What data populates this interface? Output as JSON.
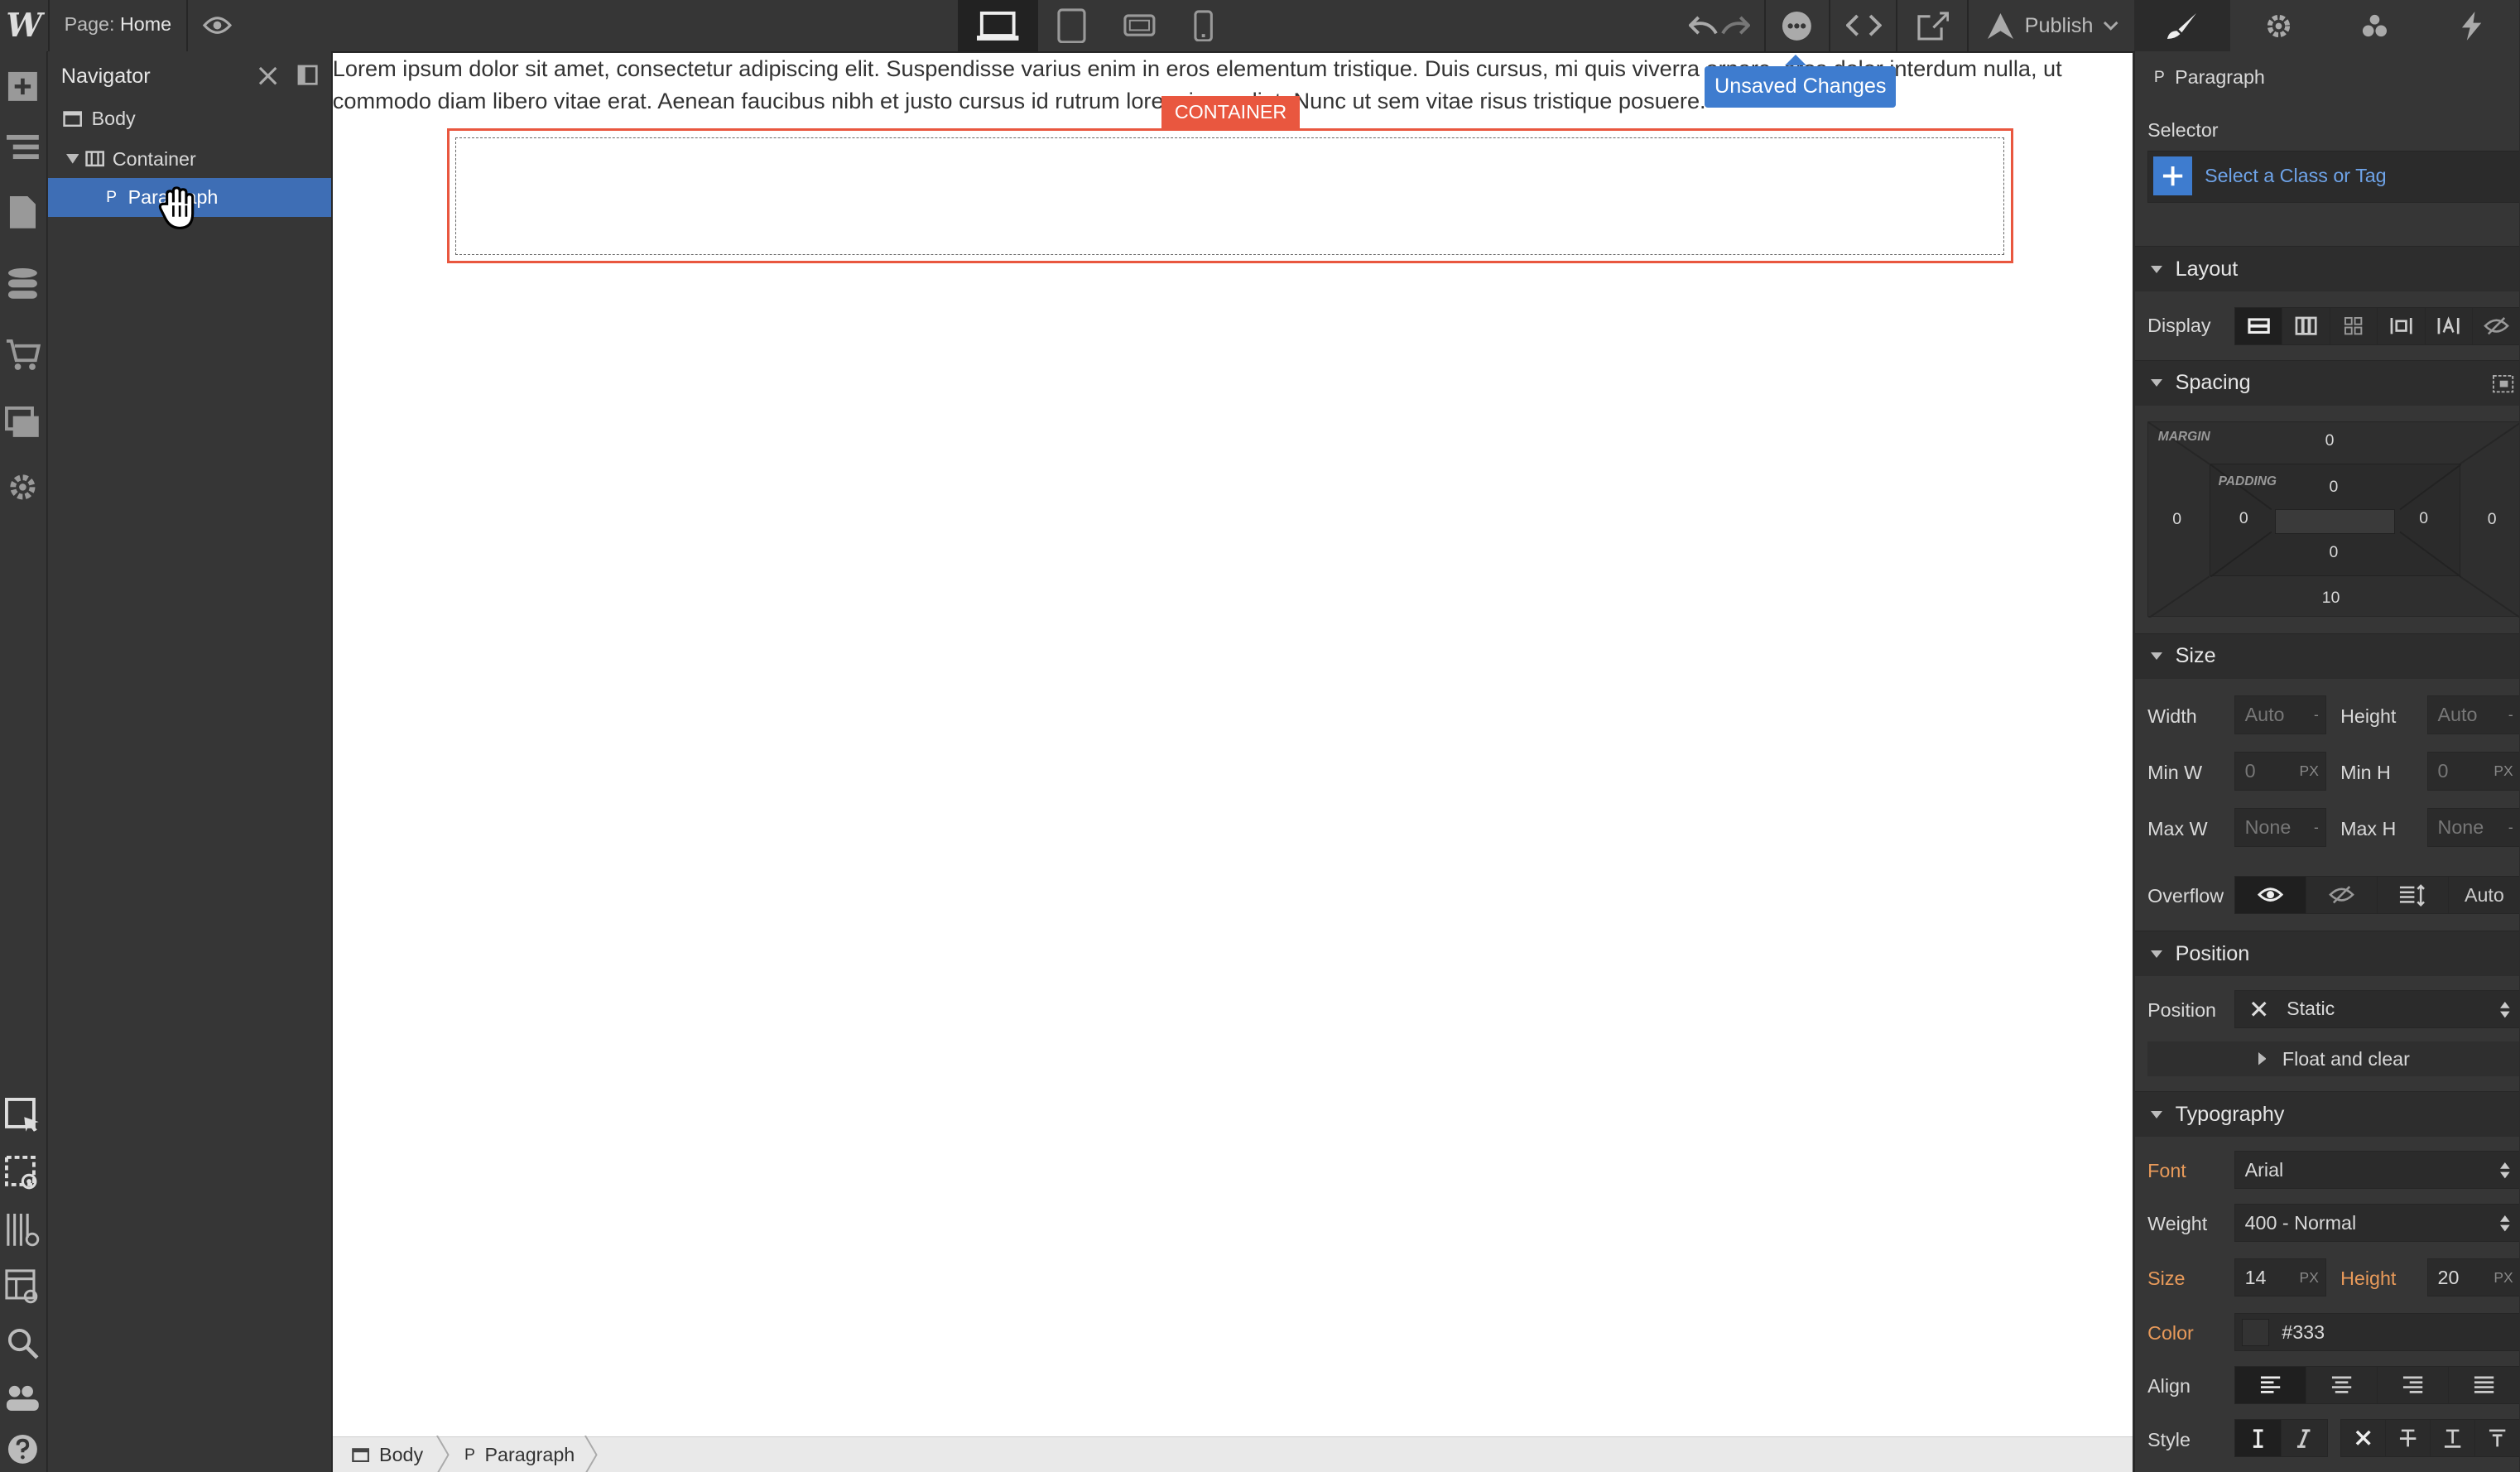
{
  "topbar": {
    "logo": "W",
    "page_prefix": "Page:",
    "page_name": "Home",
    "publish_label": "Publish",
    "icons": [
      "eye-icon",
      "desktop-icon",
      "tablet-icon",
      "landscape-icon",
      "phone-icon",
      "undo-icon",
      "redo-icon",
      "comments-icon",
      "code-icon",
      "export-icon",
      "publish-rocket-icon",
      "chevron-down-icon"
    ]
  },
  "rail": {
    "icons": [
      "add-icon",
      "navigator-icon",
      "pages-icon",
      "cms-icon",
      "ecommerce-icon",
      "assets-icon",
      "settings-icon",
      "select-icon",
      "preview-select-icon",
      "grid-overlay-icon",
      "style-manager-icon",
      "search-icon",
      "users-icon",
      "help-icon"
    ]
  },
  "navigator": {
    "title": "Navigator",
    "rows": [
      {
        "label": "Body",
        "tag": ""
      },
      {
        "label": "Container",
        "tag": ""
      },
      {
        "label": "Paragraph",
        "tag": "P"
      }
    ]
  },
  "canvas": {
    "paragraph": "Lorem ipsum dolor sit amet, consectetur adipiscing elit. Suspendisse varius enim in eros elementum tristique. Duis cursus, mi quis viverra ornare, eros dolor interdum nulla, ut commodo diam libero vitae erat. Aenean faucibus nibh et justo cursus id rutrum lorem imperdiet. Nunc ut sem vitae risus tristique posuere.",
    "container_tag": "CONTAINER",
    "unsaved": "Unsaved Changes"
  },
  "breadcrumb": [
    {
      "label": "Body",
      "tag": ""
    },
    {
      "label": "Paragraph",
      "tag": "P"
    }
  ],
  "panel": {
    "element_tag": "P",
    "element_name": "Paragraph",
    "selector_label": "Selector",
    "selector_placeholder": "Select a Class or Tag",
    "layout": {
      "title": "Layout",
      "display_label": "Display"
    },
    "spacing": {
      "title": "Spacing",
      "margin_label": "MARGIN",
      "padding_label": "PADDING",
      "margin": {
        "top": "0",
        "right": "0",
        "bottom": "10",
        "left": "0"
      },
      "padding": {
        "top": "0",
        "right": "0",
        "bottom": "0",
        "left": "0"
      }
    },
    "size": {
      "title": "Size",
      "width_label": "Width",
      "width": "Auto",
      "height_label": "Height",
      "height": "Auto",
      "minw_label": "Min W",
      "minw": "0",
      "minh_label": "Min H",
      "minh": "0",
      "maxw_label": "Max W",
      "maxw": "None",
      "maxh_label": "Max H",
      "maxh": "None",
      "unit_px": "PX",
      "unit_dash": "-",
      "overflow_label": "Overflow",
      "overflow_auto": "Auto"
    },
    "position": {
      "title": "Position",
      "label": "Position",
      "value": "Static",
      "float_label": "Float and clear"
    },
    "typography": {
      "title": "Typography",
      "font_label": "Font",
      "font": "Arial",
      "weight_label": "Weight",
      "weight": "400 - Normal",
      "size_label": "Size",
      "size": "14",
      "height_label": "Height",
      "height": "20",
      "unit_px": "PX",
      "color_label": "Color",
      "color": "#333",
      "align_label": "Align",
      "style_label": "Style"
    }
  },
  "colors": {
    "accent_blue": "#3e6eb5",
    "container_orange": "#e9573f",
    "text_color": "#333333"
  }
}
